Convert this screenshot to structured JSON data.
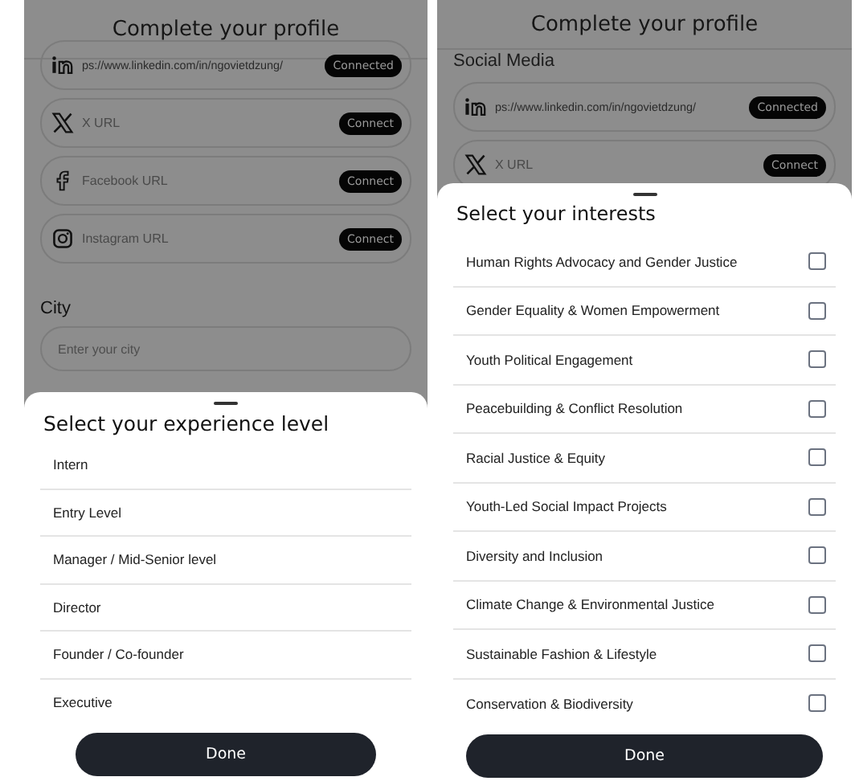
{
  "screens": [
    {
      "title": "Complete your profile",
      "social_links": [
        {
          "kind": "in",
          "value": "ps://www.linkedin.com/in/ngovietdzung/",
          "button": "Connected"
        },
        {
          "kind": "x",
          "placeholder": "X URL",
          "button": "Connect"
        },
        {
          "kind": "f",
          "placeholder": "Facebook URL",
          "button": "Connect"
        },
        {
          "kind": "camera",
          "placeholder": "Instagram URL",
          "button": "Connect"
        }
      ],
      "city": {
        "label": "City",
        "placeholder": "Enter your city"
      },
      "sheet": {
        "kind": "single",
        "title": "Select your experience level",
        "done": "Done",
        "options": [
          {
            "label": "Intern"
          },
          {
            "label": "Entry Level"
          },
          {
            "label": "Manager / Mid-Senior level"
          },
          {
            "label": "Director"
          },
          {
            "label": "Founder / Co-founder"
          },
          {
            "label": "Executive"
          }
        ]
      }
    },
    {
      "title": "Complete your profile",
      "section_label": "Social Media",
      "social_links": [
        {
          "kind": "in",
          "value": "ps://www.linkedin.com/in/ngovietdzung/",
          "button": "Connected"
        },
        {
          "kind": "x",
          "placeholder": "X URL",
          "button": "Connect"
        }
      ],
      "sheet": {
        "kind": "multi",
        "title": "Select your interests",
        "done": "Done",
        "options": [
          {
            "label": "Human Rights Advocacy and Gender Justice",
            "checked": false
          },
          {
            "label": "Gender Equality & Women Empowerment",
            "checked": false
          },
          {
            "label": "Youth Political Engagement",
            "checked": false
          },
          {
            "label": "Peacebuilding & Conflict Resolution",
            "checked": false
          },
          {
            "label": "Racial Justice & Equity",
            "checked": false
          },
          {
            "label": "Youth-Led Social Impact Projects",
            "checked": false
          },
          {
            "label": "Diversity and Inclusion",
            "checked": false
          },
          {
            "label": "Climate Change & Environmental Justice",
            "checked": false
          },
          {
            "label": "Sustainable Fashion & Lifestyle",
            "checked": false
          },
          {
            "label": "Conservation & Biodiversity",
            "checked": false
          }
        ]
      }
    }
  ]
}
